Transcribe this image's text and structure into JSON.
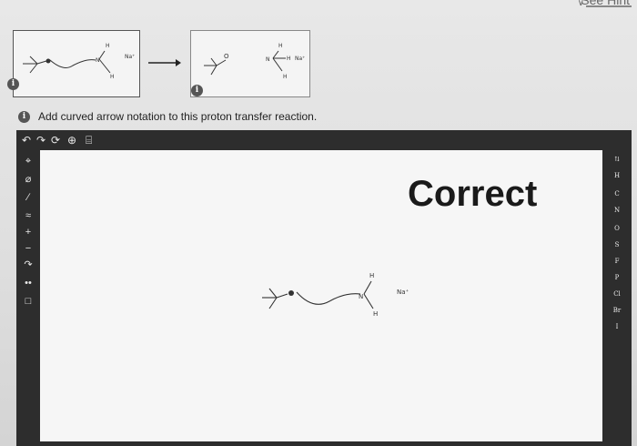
{
  "header": {
    "hint_label": "See Hint"
  },
  "scheme": {
    "box1_na": "Na⁺",
    "box1_h_top": "H",
    "box1_h_bottom": "H",
    "box2_na": "Na⁺",
    "box2_h_top": "H",
    "box2_h_bottom": "H",
    "box2_h_side": "H",
    "badge_label": "i"
  },
  "question": {
    "instruction": "Add curved arrow notation to this proton transfer reaction."
  },
  "toolbar": {
    "undo": "↶",
    "redo": "↷",
    "reset": "⟳",
    "zoom": "⊕",
    "template": "⌸"
  },
  "left_tools": [
    "⌖",
    "⌀",
    "∕",
    "≈",
    "+",
    "−",
    "↷",
    "••",
    "□"
  ],
  "right_elements": [
    "H",
    "C",
    "N",
    "O",
    "S",
    "F",
    "P",
    "Cl",
    "Br",
    "I"
  ],
  "right_header": "⇅",
  "canvas": {
    "status": "Correct",
    "na_label": "Na⁺",
    "h_top": "H",
    "h_bottom": "H"
  }
}
